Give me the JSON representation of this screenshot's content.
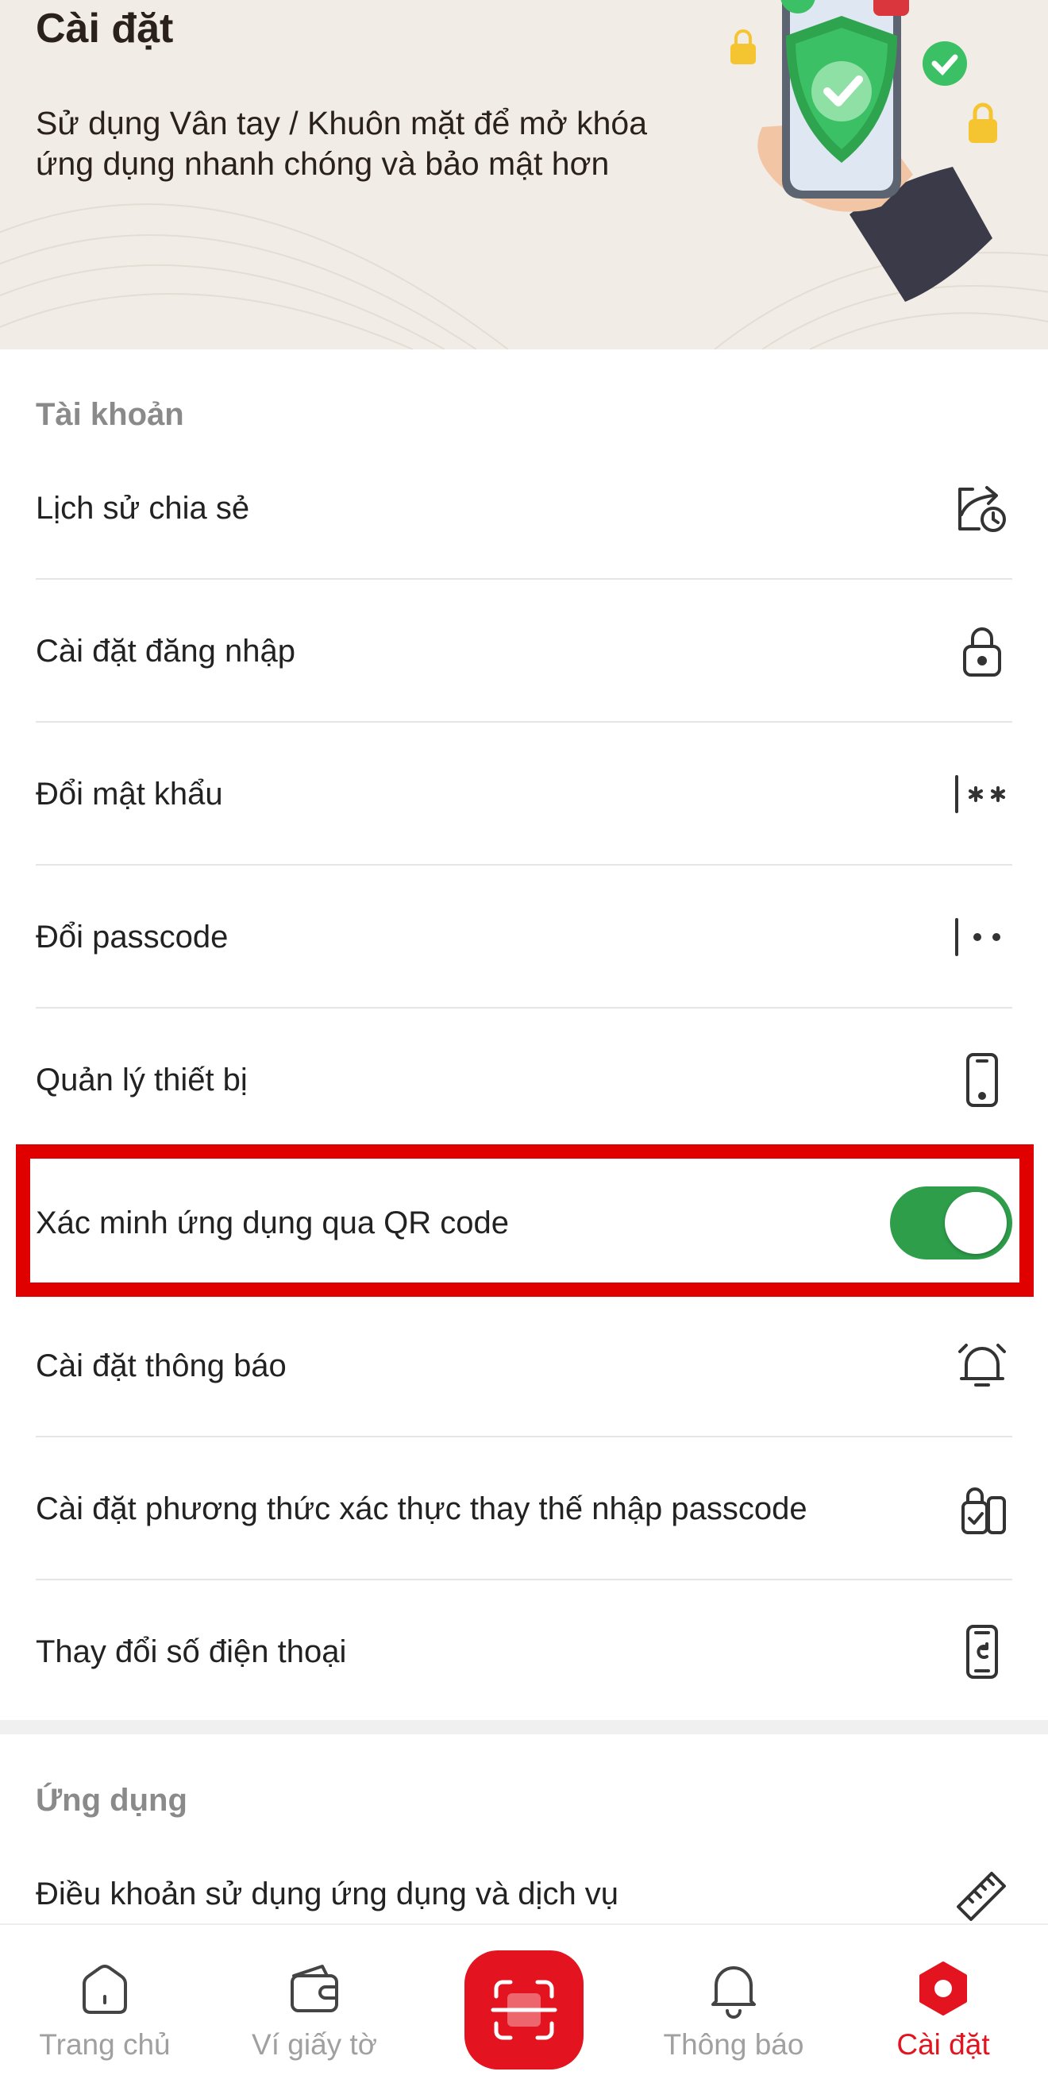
{
  "header": {
    "title": "Cài đặt",
    "description": "Sử dụng Vân tay / Khuôn mặt để mở khóa ứng dụng nhanh chóng và bảo mật hơn"
  },
  "account_section": {
    "title": "Tài khoản",
    "items": [
      {
        "label": "Lịch sử chia sẻ",
        "icon": "share-history-icon"
      },
      {
        "label": "Cài đặt đăng nhập",
        "icon": "lock-icon"
      },
      {
        "label": "Đổi mật khẩu",
        "icon": "password-asterisk-icon"
      },
      {
        "label": "Đổi passcode",
        "icon": "passcode-dots-icon"
      },
      {
        "label": "Quản lý thiết bị",
        "icon": "phone-device-icon"
      },
      {
        "label": "Xác minh ứng dụng qua QR code",
        "icon": "toggle",
        "enabled": true
      },
      {
        "label": "Cài đặt thông báo",
        "icon": "alarm-bell-icon"
      },
      {
        "label": "Cài đặt phương thức xác thực thay thế nhập passcode",
        "icon": "secure-phone-check-icon"
      },
      {
        "label": "Thay đổi số điện thoại",
        "icon": "phone-change-icon"
      }
    ]
  },
  "app_section": {
    "title": "Ứng dụng",
    "items": [
      {
        "label": "Điều khoản sử dụng ứng dụng và dịch vụ",
        "icon": "ruler-icon"
      }
    ]
  },
  "bottom_nav": {
    "items": [
      {
        "label": "Trang chủ",
        "icon": "home-icon",
        "active": false
      },
      {
        "label": "Ví giấy tờ",
        "icon": "wallet-icon",
        "active": false
      },
      {
        "label": "",
        "icon": "scan-icon",
        "active": false
      },
      {
        "label": "Thông báo",
        "icon": "bell-icon",
        "active": false
      },
      {
        "label": "Cài đặt",
        "icon": "settings-hexagon-icon",
        "active": true
      }
    ]
  },
  "colors": {
    "accent": "#e3141f",
    "toggle_on": "#2e9e4b",
    "highlight": "#e10000",
    "banner_bg": "#f1ece6"
  }
}
